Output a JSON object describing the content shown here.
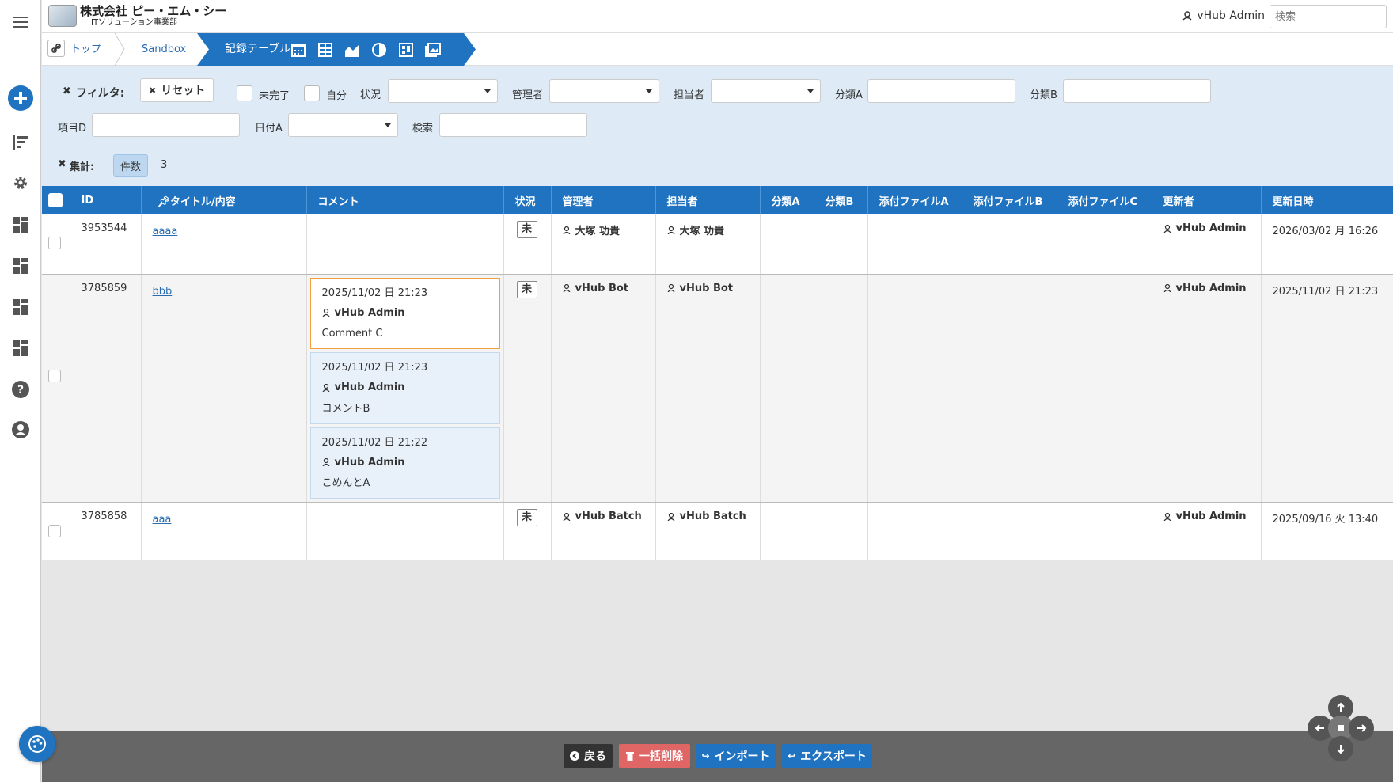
{
  "header": {
    "company_name": "株式会社 ピー・エム・シー",
    "division": "ITソリューション事業部",
    "user": "vHub Admin",
    "search_placeholder": "検索"
  },
  "breadcrumb": {
    "home": "トップ",
    "sandbox": "Sandbox",
    "current": "記録テーブル"
  },
  "filter": {
    "title": "フィルタ:",
    "reset": "リセット",
    "incomplete": "未完了",
    "mine": "自分",
    "status": "状況",
    "manager": "管理者",
    "assignee": "担当者",
    "category_a": "分類A",
    "category_b": "分類B",
    "item_d": "項目D",
    "date_a": "日付A",
    "search": "検索"
  },
  "aggregate": {
    "title": "集計:",
    "badge": "件数",
    "count": "3"
  },
  "table": {
    "columns": [
      "ID",
      "タイトル/内容",
      "コメント",
      "状況",
      "管理者",
      "担当者",
      "分類A",
      "分類B",
      "添付ファイルA",
      "添付ファイルB",
      "添付ファイルC",
      "更新者",
      "更新日時"
    ],
    "rows": [
      {
        "id": "3953544",
        "title": "aaaa",
        "status": "未",
        "manager": "大塚 功貴",
        "assignee": "大塚 功貴",
        "updater": "vHub Admin",
        "updated": "2026/03/02 月 16:26"
      },
      {
        "id": "3785859",
        "title": "bbb",
        "status": "未",
        "manager": "vHub Bot",
        "assignee": "vHub Bot",
        "updater": "vHub Admin",
        "updated": "2025/11/02 日 21:23",
        "comments": [
          {
            "date": "2025/11/02 日 21:23",
            "user": "vHub Admin",
            "text": "Comment C"
          },
          {
            "date": "2025/11/02 日 21:23",
            "user": "vHub Admin",
            "text": "コメントB"
          },
          {
            "date": "2025/11/02 日 21:22",
            "user": "vHub Admin",
            "text": "こめんとA"
          }
        ]
      },
      {
        "id": "3785858",
        "title": "aaa",
        "status": "未",
        "manager": "vHub Batch",
        "assignee": "vHub Batch",
        "updater": "vHub Admin",
        "updated": "2025/09/16 火 13:40"
      }
    ]
  },
  "footer": {
    "back": "戻る",
    "bulk_delete": "一括削除",
    "import": "インポート",
    "export": "エクスポート"
  },
  "colors": {
    "primary": "#1f73c0",
    "filter_bg": "#deebf7",
    "delete": "#e06666",
    "back": "#333333"
  }
}
